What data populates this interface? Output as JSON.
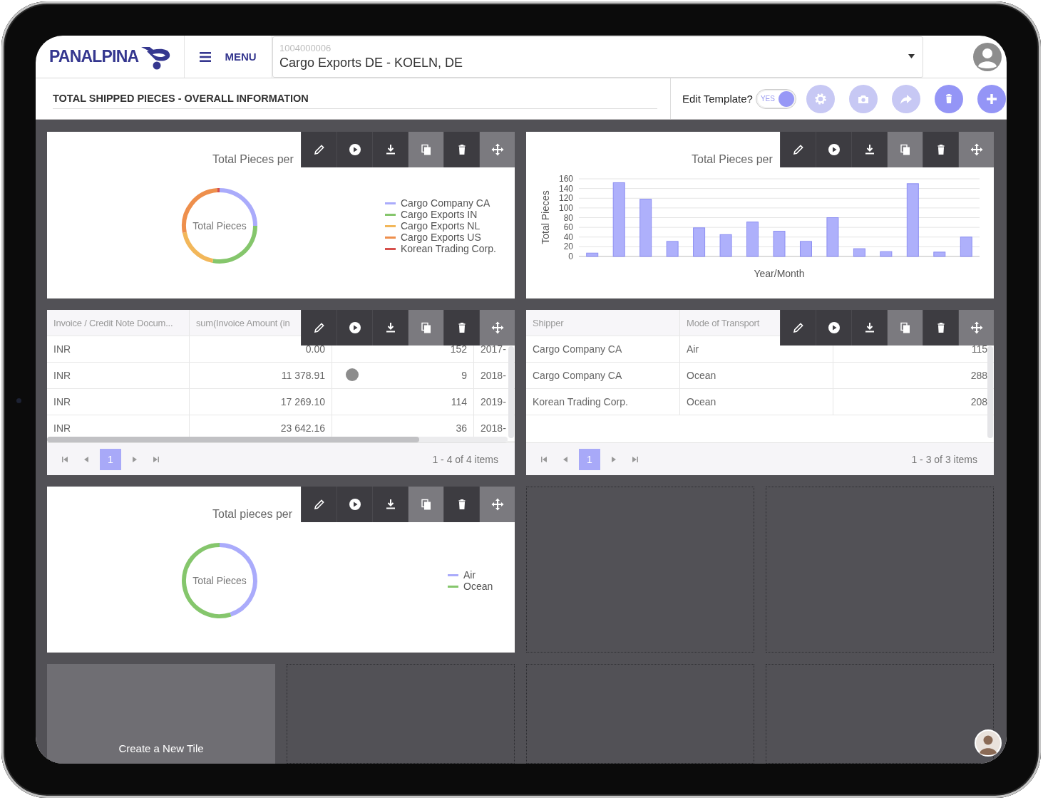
{
  "header": {
    "logo": "PANALPINA",
    "menu_label": "MENU",
    "account": {
      "id": "1004000006",
      "value": "Cargo Exports DE - KOELN, DE"
    }
  },
  "page_title": "TOTAL SHIPPED PIECES - OVERALL INFORMATION",
  "edit_template": {
    "label": "Edit Template?",
    "toggle_text": "YES",
    "on": true
  },
  "actions": [
    {
      "kind": "settings",
      "disabled": true
    },
    {
      "kind": "camera",
      "disabled": true
    },
    {
      "kind": "share",
      "disabled": true
    },
    {
      "kind": "delete",
      "disabled": false
    },
    {
      "kind": "add",
      "disabled": false
    }
  ],
  "tile_tools": [
    {
      "kind": "edit",
      "disabled": false
    },
    {
      "kind": "play",
      "disabled": false
    },
    {
      "kind": "download",
      "disabled": false
    },
    {
      "kind": "copy",
      "disabled": true
    },
    {
      "kind": "delete",
      "disabled": false
    },
    {
      "kind": "move",
      "disabled": true
    }
  ],
  "tiles": [
    {
      "kind": "donut",
      "title": "Total Pieces per",
      "center_label": "Total Pieces",
      "legend": [
        {
          "label": "Cargo Company CA",
          "color": "#aaabfb"
        },
        {
          "label": "Cargo Exports IN",
          "color": "#85c66c"
        },
        {
          "label": "Cargo Exports NL",
          "color": "#f2b75a"
        },
        {
          "label": "Cargo Exports US",
          "color": "#ee8f4c"
        },
        {
          "label": "Korean Trading Corp.",
          "color": "#d6504c"
        }
      ]
    },
    {
      "kind": "bar",
      "title": "Total Pieces per",
      "chart_data": {
        "type": "bar",
        "grid": true,
        "xlabel": "Year/Month",
        "ylabel": "Total Pieces",
        "ylim": [
          0,
          160
        ],
        "yticks": [
          0,
          20,
          40,
          60,
          80,
          100,
          120,
          140,
          160
        ],
        "values": [
          7,
          152,
          118,
          31,
          59,
          45,
          71,
          52,
          31,
          80,
          16,
          10,
          150,
          9,
          40
        ]
      }
    },
    {
      "kind": "table",
      "columns": [
        {
          "label": "Invoice / Credit Note Docum...",
          "kind": "text"
        },
        {
          "label": "sum(Invoice Amount (in",
          "kind": "number"
        },
        {
          "kind": "number"
        },
        {
          "kind": "text"
        }
      ],
      "rows": [
        [
          "INR",
          "0.00",
          "152",
          "2017-"
        ],
        [
          "INR",
          "11 378.91",
          "9",
          "2018-"
        ],
        [
          "INR",
          "17 269.10",
          "114",
          "2019-"
        ],
        [
          "INR",
          "23 642.16",
          "36",
          "2018-"
        ]
      ],
      "pages": [
        {
          "label": "1",
          "selected": true
        }
      ],
      "summary": "1 - 4 of 4 items"
    },
    {
      "kind": "table",
      "columns": [
        {
          "label": "Shipper",
          "kind": "text"
        },
        {
          "label": "Mode of Transport",
          "kind": "text"
        },
        {
          "kind": "number"
        }
      ],
      "rows": [
        [
          "Cargo Company CA",
          "Air",
          "115"
        ],
        [
          "Cargo Company CA",
          "Ocean",
          "288"
        ],
        [
          "Korean Trading Corp.",
          "Ocean",
          "208"
        ]
      ],
      "pages": [
        {
          "label": "1",
          "selected": true
        }
      ],
      "summary": "1 - 3 of 3 items"
    },
    {
      "kind": "donut",
      "title": "Total pieces per",
      "center_label": "Total Pieces",
      "legend": [
        {
          "label": "Air",
          "color": "#aaabfb"
        },
        {
          "label": "Ocean",
          "color": "#85c66c"
        }
      ]
    }
  ],
  "create_tile": "Create a New Tile"
}
